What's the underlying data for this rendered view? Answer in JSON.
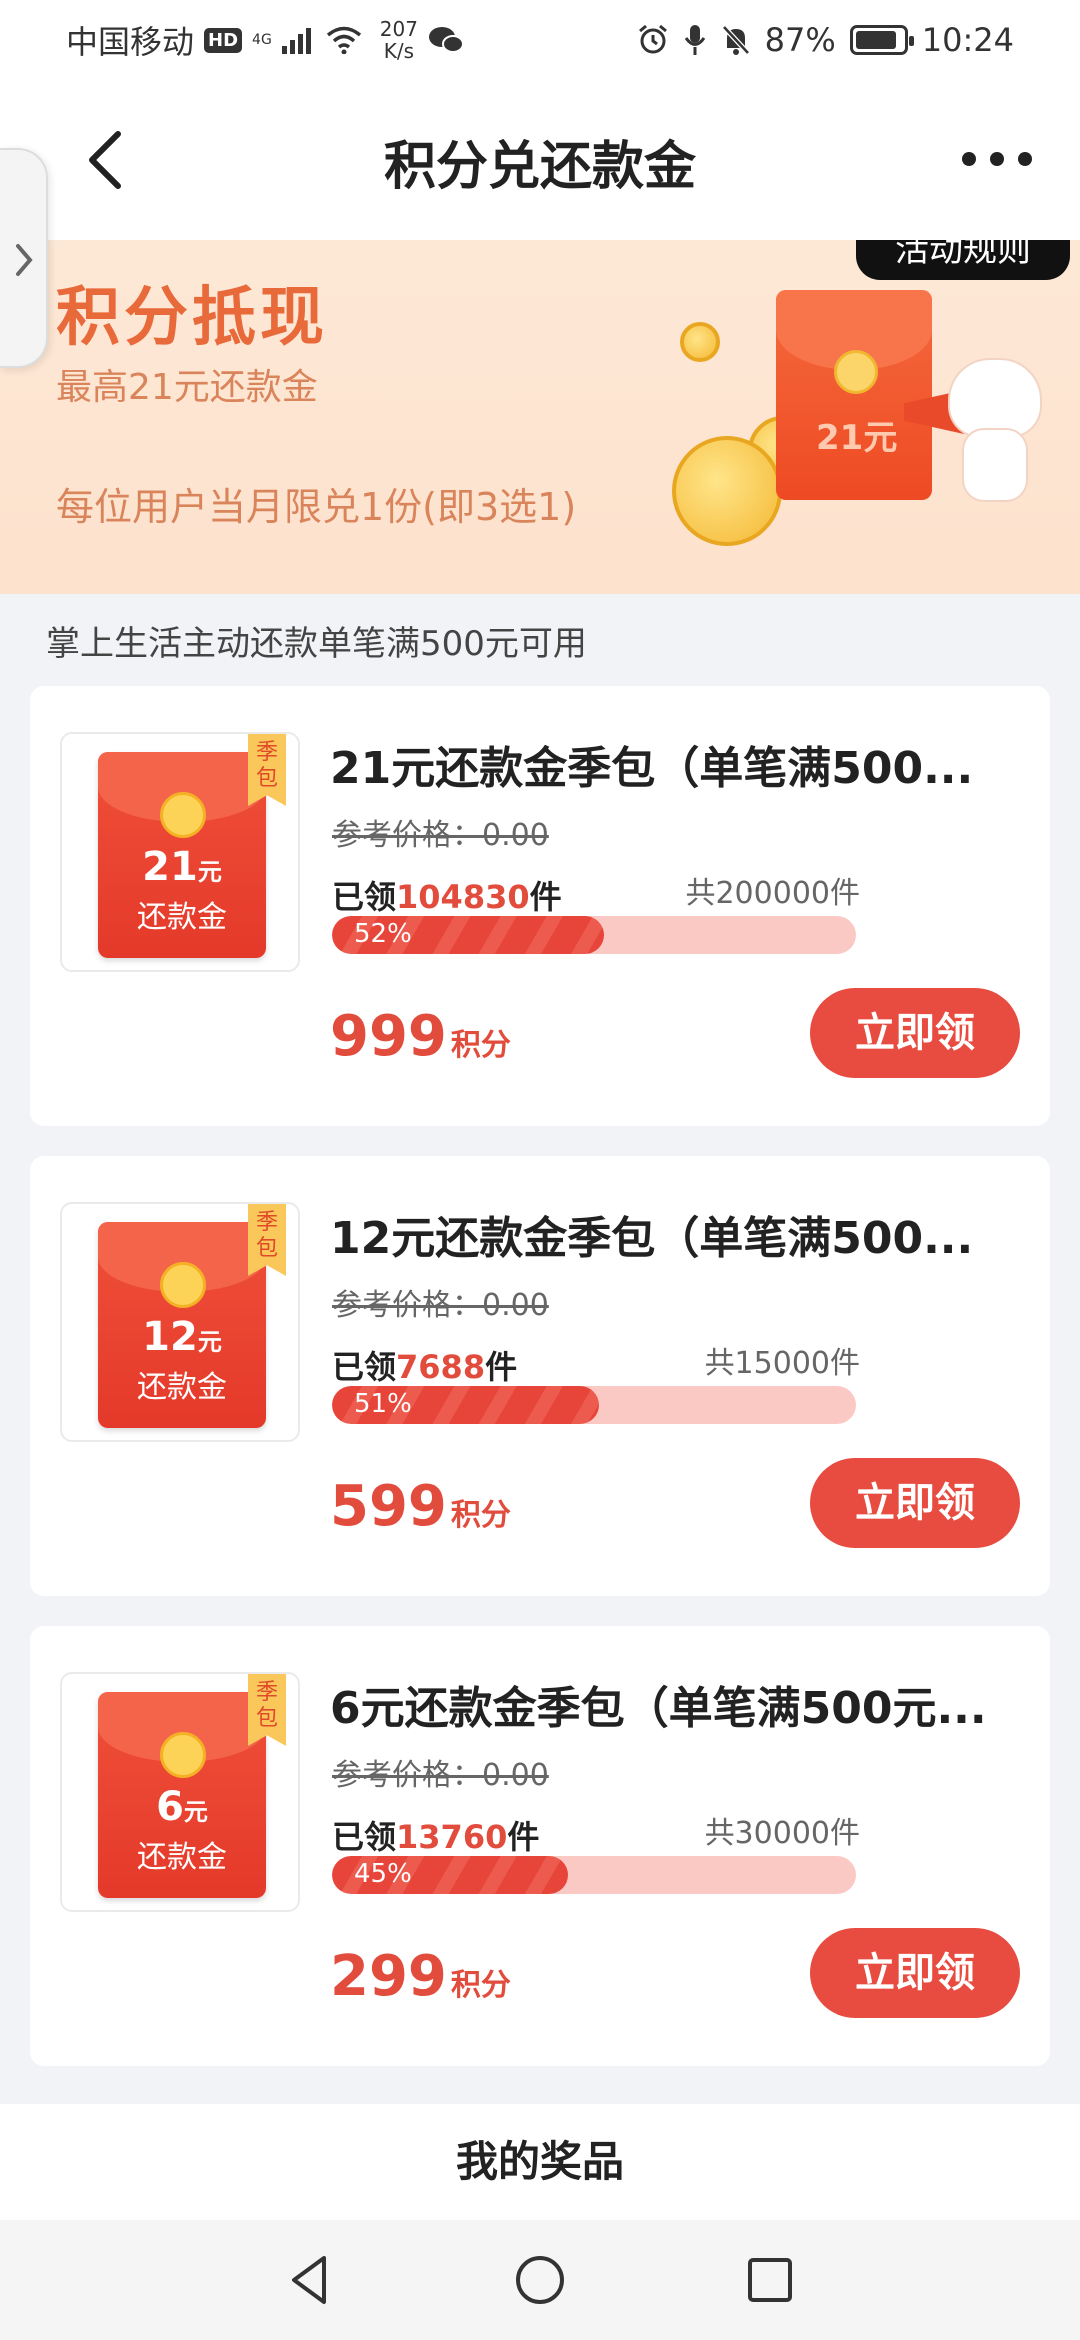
{
  "status_bar": {
    "carrier": "中国移动",
    "hd": "HD",
    "network_top": "4G",
    "speed_value": "207",
    "speed_unit": "K/s",
    "battery": "87%",
    "battery_level": 0.87,
    "time": "10:24"
  },
  "nav": {
    "title": "积分兑还款金"
  },
  "banner": {
    "title": "积分抵现",
    "subtitle": "最高21元还款金",
    "limit": "每位用户当月限兑1份(即3选1)",
    "rules": "活动规则",
    "envelope_text": "21元"
  },
  "note": "掌上生活主动还款单笔满500元可用",
  "products": [
    {
      "title": "21元还款金季包（单笔满500...",
      "ref_price": "参考价格：0.00",
      "claimed_prefix": "已领",
      "claimed_count": "104830",
      "claimed_suffix": "件",
      "total": "共200000件",
      "progress": "52%",
      "progress_value": 0.52,
      "points": "999",
      "points_unit": "积分",
      "button": "立即领",
      "env_amount": "21",
      "env_unit": "元",
      "env_label": "还款金",
      "tag": "季包"
    },
    {
      "title": "12元还款金季包（单笔满500...",
      "ref_price": "参考价格：0.00",
      "claimed_prefix": "已领",
      "claimed_count": "7688",
      "claimed_suffix": "件",
      "total": "共15000件",
      "progress": "51%",
      "progress_value": 0.51,
      "points": "599",
      "points_unit": "积分",
      "button": "立即领",
      "env_amount": "12",
      "env_unit": "元",
      "env_label": "还款金",
      "tag": "季包"
    },
    {
      "title": "6元还款金季包（单笔满500元...",
      "ref_price": "参考价格：0.00",
      "claimed_prefix": "已领",
      "claimed_count": "13760",
      "claimed_suffix": "件",
      "total": "共30000件",
      "progress": "45%",
      "progress_value": 0.45,
      "points": "299",
      "points_unit": "积分",
      "button": "立即领",
      "env_amount": "6",
      "env_unit": "元",
      "env_label": "还款金",
      "tag": "季包"
    }
  ],
  "my_prizes": "我的奖品",
  "icons": {
    "back": "chevron-left-icon",
    "more": "more-dots-icon",
    "side": "chevron-right-icon",
    "sys_back": "triangle-back-icon",
    "sys_home": "circle-home-icon",
    "sys_recent": "square-recent-icon"
  }
}
